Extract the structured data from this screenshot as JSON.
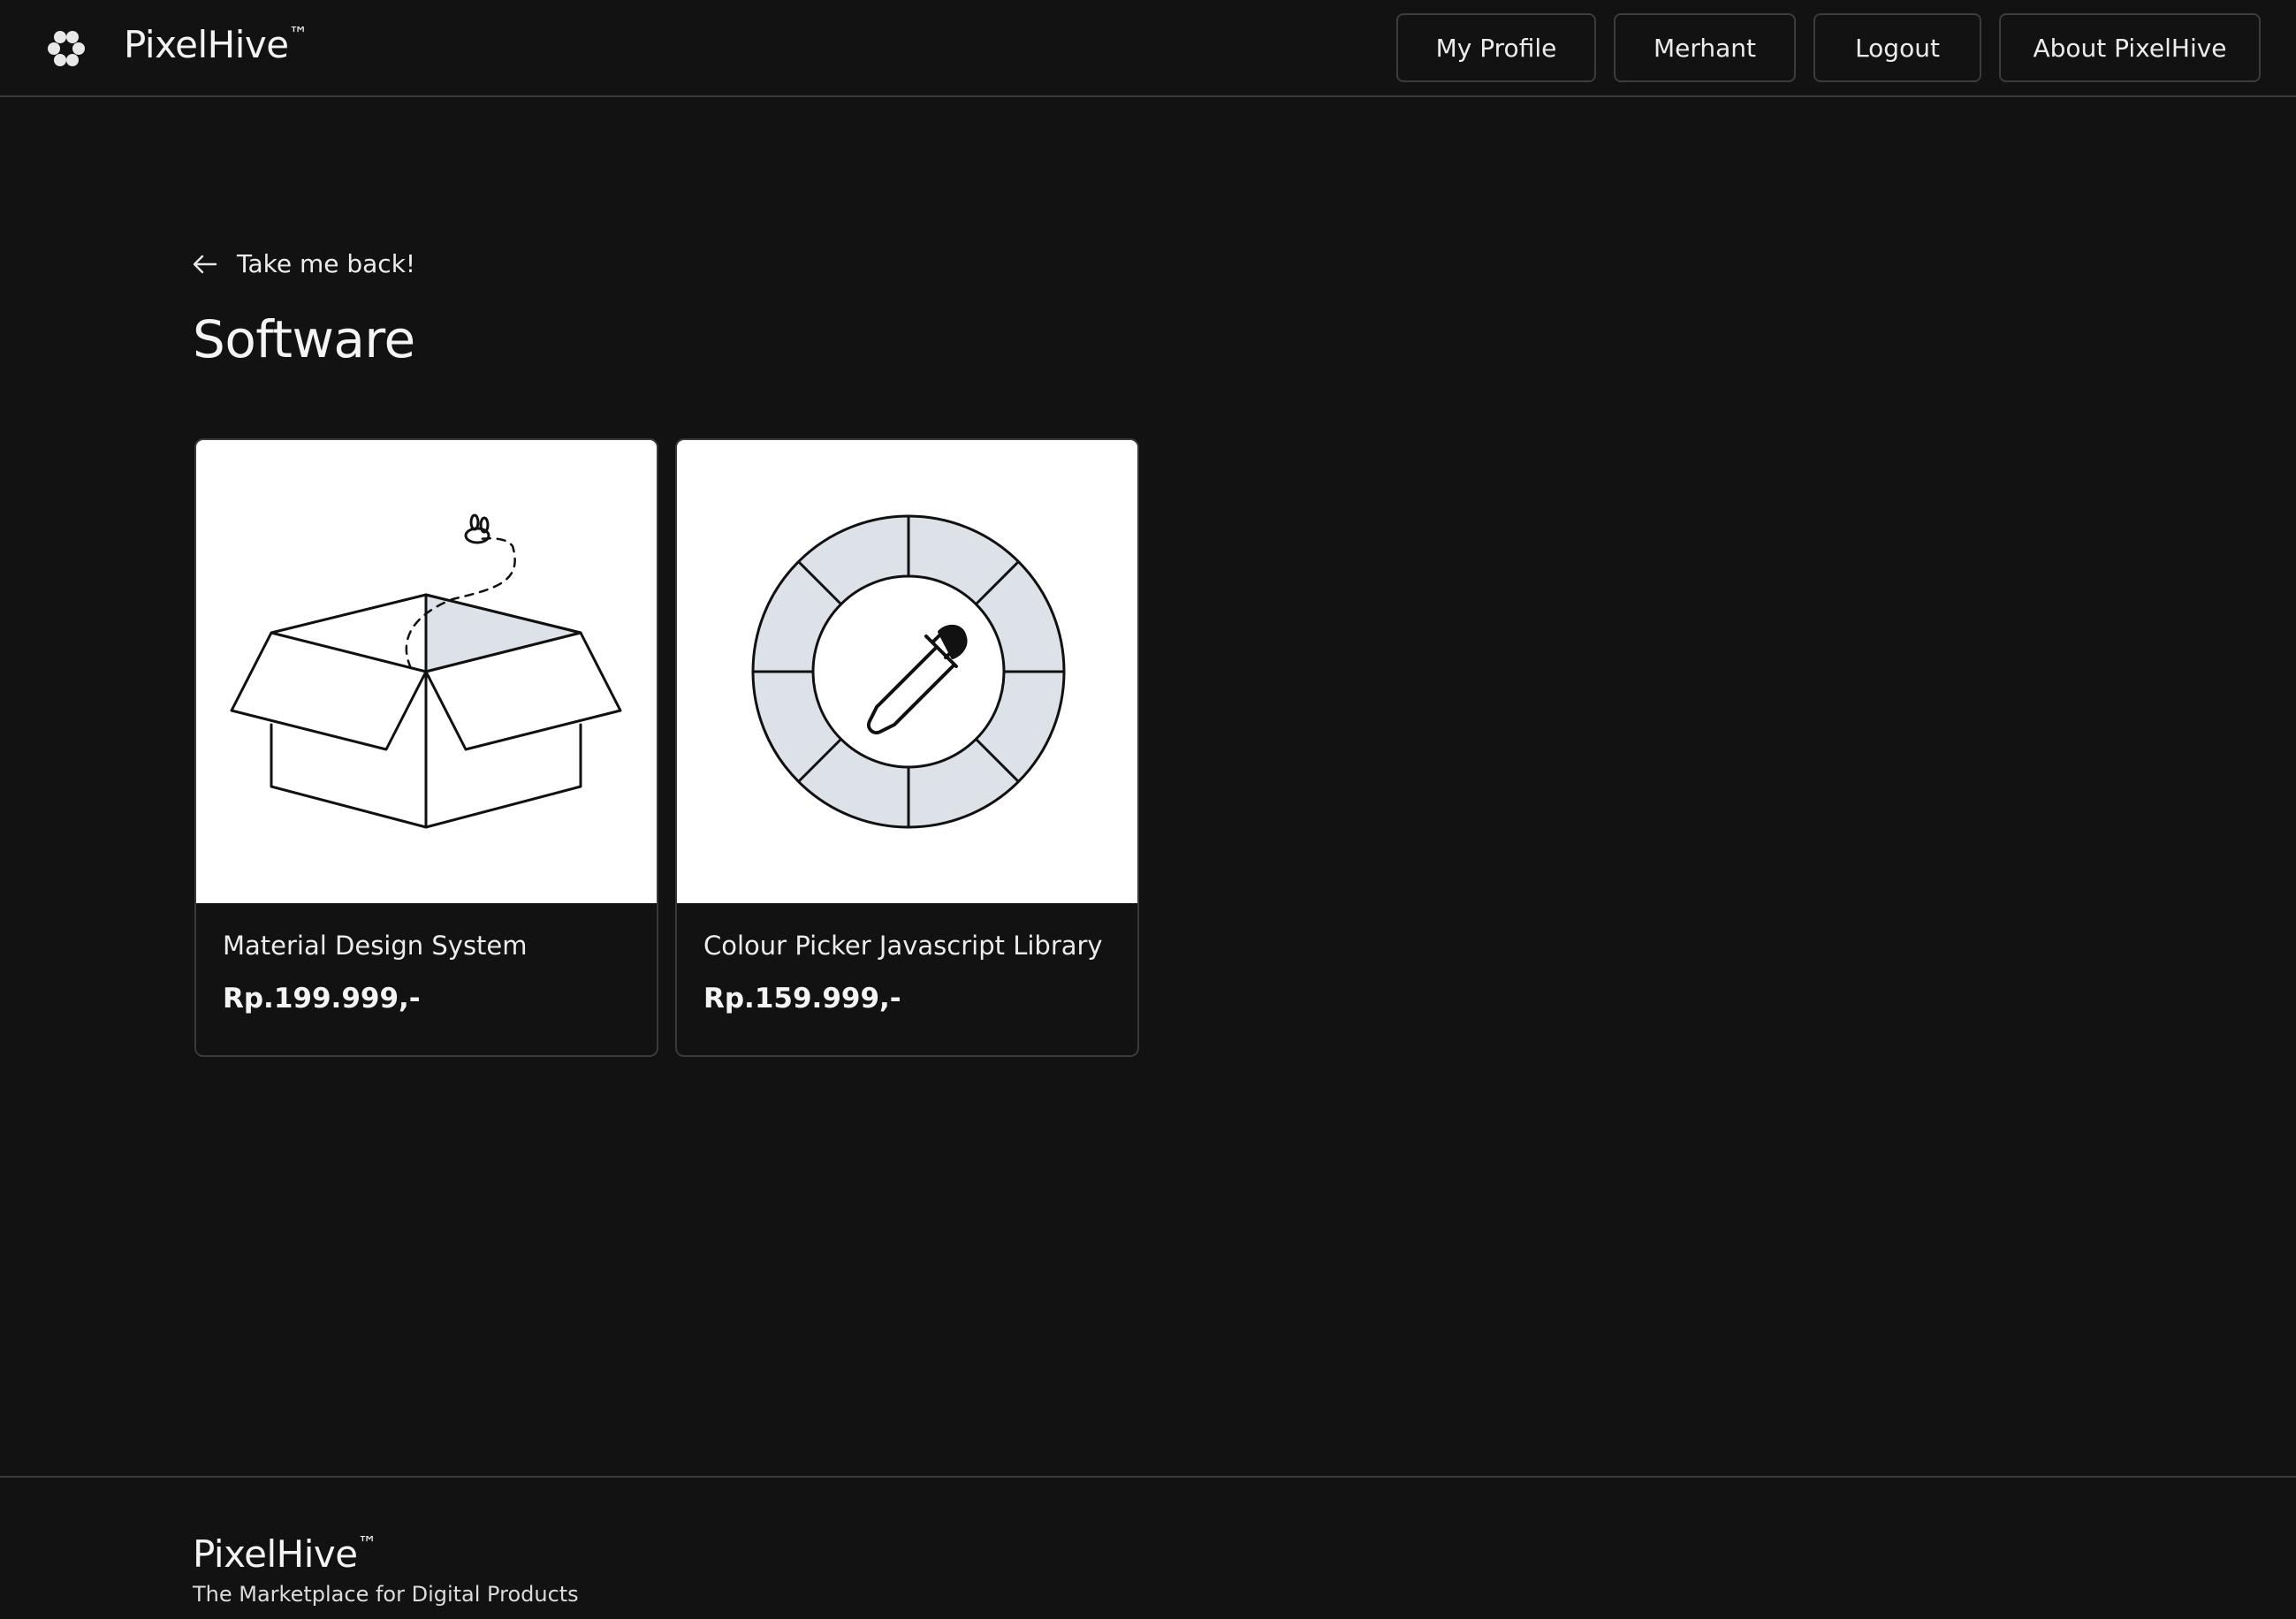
{
  "header": {
    "brand": "PixelHive",
    "brand_mark": "™",
    "nav": {
      "profile": "My Profile",
      "merchant": "Merhant",
      "logout": "Logout",
      "about": "About PixelHive"
    }
  },
  "main": {
    "back_label": "Take me back!",
    "title": "Software",
    "products": [
      {
        "name": "Material Design System",
        "price": "Rp.199.999,-",
        "image_icon": "open-box-with-bee-illustration"
      },
      {
        "name": "Colour Picker Javascript Library",
        "price": "Rp.159.999,-",
        "image_icon": "color-wheel-eyedropper-illustration"
      }
    ]
  },
  "footer": {
    "brand": "PixelHive",
    "brand_mark": "™",
    "tagline": "The Marketplace for Digital Products"
  },
  "colors": {
    "background": "#121212",
    "text": "#f4f4f4",
    "border": "#3a3a3a",
    "illustration_fill": "#dde2e8"
  }
}
